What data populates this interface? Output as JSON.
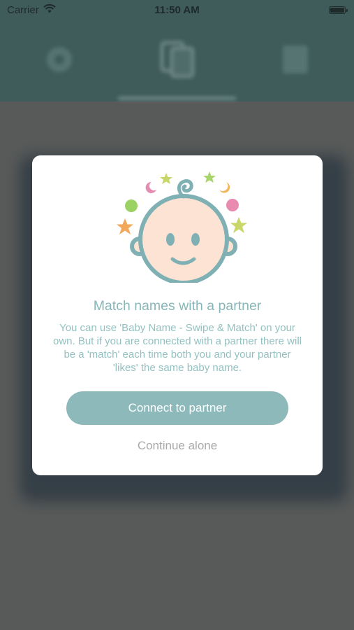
{
  "status_bar": {
    "carrier": "Carrier",
    "time": "11:50 AM"
  },
  "tabs": [
    {
      "icon": "settings-icon"
    },
    {
      "icon": "swipe-cards-icon"
    },
    {
      "icon": "list-icon"
    }
  ],
  "dialog": {
    "title": "Match names with a partner",
    "body": "You can use 'Baby Name - Swipe & Match' on your own. But if you are connected with a partner there will be a 'match' each time both you and your partner 'likes' the same baby name.",
    "connect_label": "Connect to partner",
    "continue_label": "Continue alone"
  },
  "colors": {
    "accent": "#8db9bb",
    "title": "#87b7b8",
    "overlay": "#585a59",
    "header": "#3f5c5a"
  }
}
